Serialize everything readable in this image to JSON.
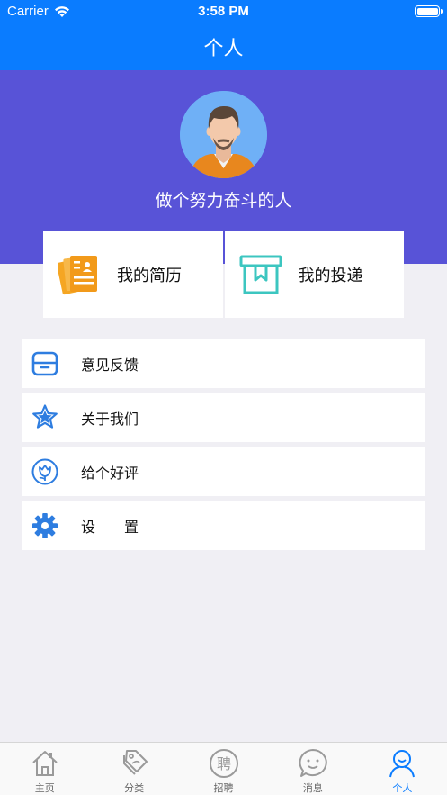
{
  "status_bar": {
    "carrier": "Carrier",
    "time": "3:58 PM"
  },
  "nav": {
    "title": "个人"
  },
  "profile": {
    "name": "做个努力奋斗的人"
  },
  "cards": [
    {
      "label": "我的简历",
      "icon": "resume-icon"
    },
    {
      "label": "我的投递",
      "icon": "delivery-box-icon"
    }
  ],
  "menu": [
    {
      "label": "意见反馈",
      "icon": "feedback-icon"
    },
    {
      "label": "关于我们",
      "icon": "star-icon"
    },
    {
      "label": "给个好评",
      "icon": "flower-icon"
    },
    {
      "label": "设　　置",
      "icon": "gear-icon"
    }
  ],
  "tabbar": {
    "items": [
      {
        "label": "主页",
        "icon": "home-icon"
      },
      {
        "label": "分类",
        "icon": "tag-icon"
      },
      {
        "label": "招聘",
        "icon": "recruit-icon",
        "glyph": "聘"
      },
      {
        "label": "消息",
        "icon": "message-icon"
      },
      {
        "label": "个人",
        "icon": "person-icon"
      }
    ],
    "active_index": 4
  },
  "colors": {
    "accent": "#0a7cff",
    "hero": "#5853d7",
    "background": "#f0eff4"
  }
}
